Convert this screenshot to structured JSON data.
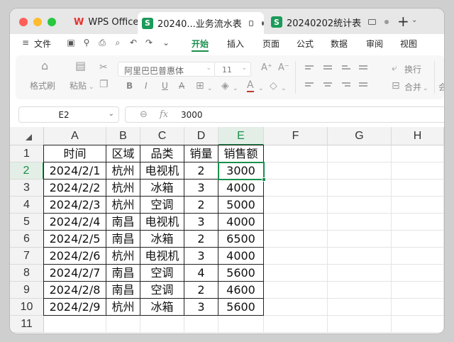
{
  "tabs": [
    {
      "label": "WPS Office",
      "icon": "wps-logo"
    },
    {
      "label": "20240...业务流水表",
      "badge": "S",
      "active": true
    },
    {
      "label": "20240202统计表",
      "badge": "S",
      "active": false
    }
  ],
  "menu": {
    "file_label": "文件",
    "items": [
      "开始",
      "插入",
      "页面",
      "公式",
      "数据",
      "审阅",
      "视图"
    ],
    "active": "开始"
  },
  "ribbon": {
    "format_painter": "格式刷",
    "paste": "粘贴",
    "font_name": "阿里巴巴普惠体",
    "font_size": "11",
    "bold": "B",
    "italic": "I",
    "underline": "U",
    "strike": "A",
    "wrap": "换行",
    "merge": "合并",
    "more": "会"
  },
  "formula_bar": {
    "name_box": "E2",
    "fx_label": "fx",
    "value": "3000"
  },
  "columns": [
    "A",
    "B",
    "C",
    "D",
    "E",
    "F",
    "G",
    "H"
  ],
  "rows": [
    "1",
    "2",
    "3",
    "4",
    "5",
    "6",
    "7",
    "8",
    "9",
    "10",
    "11"
  ],
  "selected_cell": {
    "column": "E",
    "row": "2"
  },
  "table": {
    "headers": [
      "时间",
      "区域",
      "品类",
      "销量",
      "销售额"
    ],
    "rows": [
      [
        "2024/2/1",
        "杭州",
        "电视机",
        "2",
        "3000"
      ],
      [
        "2024/2/2",
        "杭州",
        "冰箱",
        "3",
        "4000"
      ],
      [
        "2024/2/3",
        "杭州",
        "空调",
        "2",
        "5000"
      ],
      [
        "2024/2/4",
        "南昌",
        "电视机",
        "3",
        "4000"
      ],
      [
        "2024/2/5",
        "南昌",
        "冰箱",
        "2",
        "6500"
      ],
      [
        "2024/2/6",
        "杭州",
        "电视机",
        "3",
        "4000"
      ],
      [
        "2024/2/7",
        "南昌",
        "空调",
        "4",
        "5600"
      ],
      [
        "2024/2/8",
        "南昌",
        "空调",
        "2",
        "4600"
      ],
      [
        "2024/2/9",
        "杭州",
        "冰箱",
        "3",
        "5600"
      ]
    ]
  },
  "colors": {
    "accent": "#1a8f4d",
    "sheet_badge": "#1b9a5a",
    "wps_red": "#e5322d"
  }
}
